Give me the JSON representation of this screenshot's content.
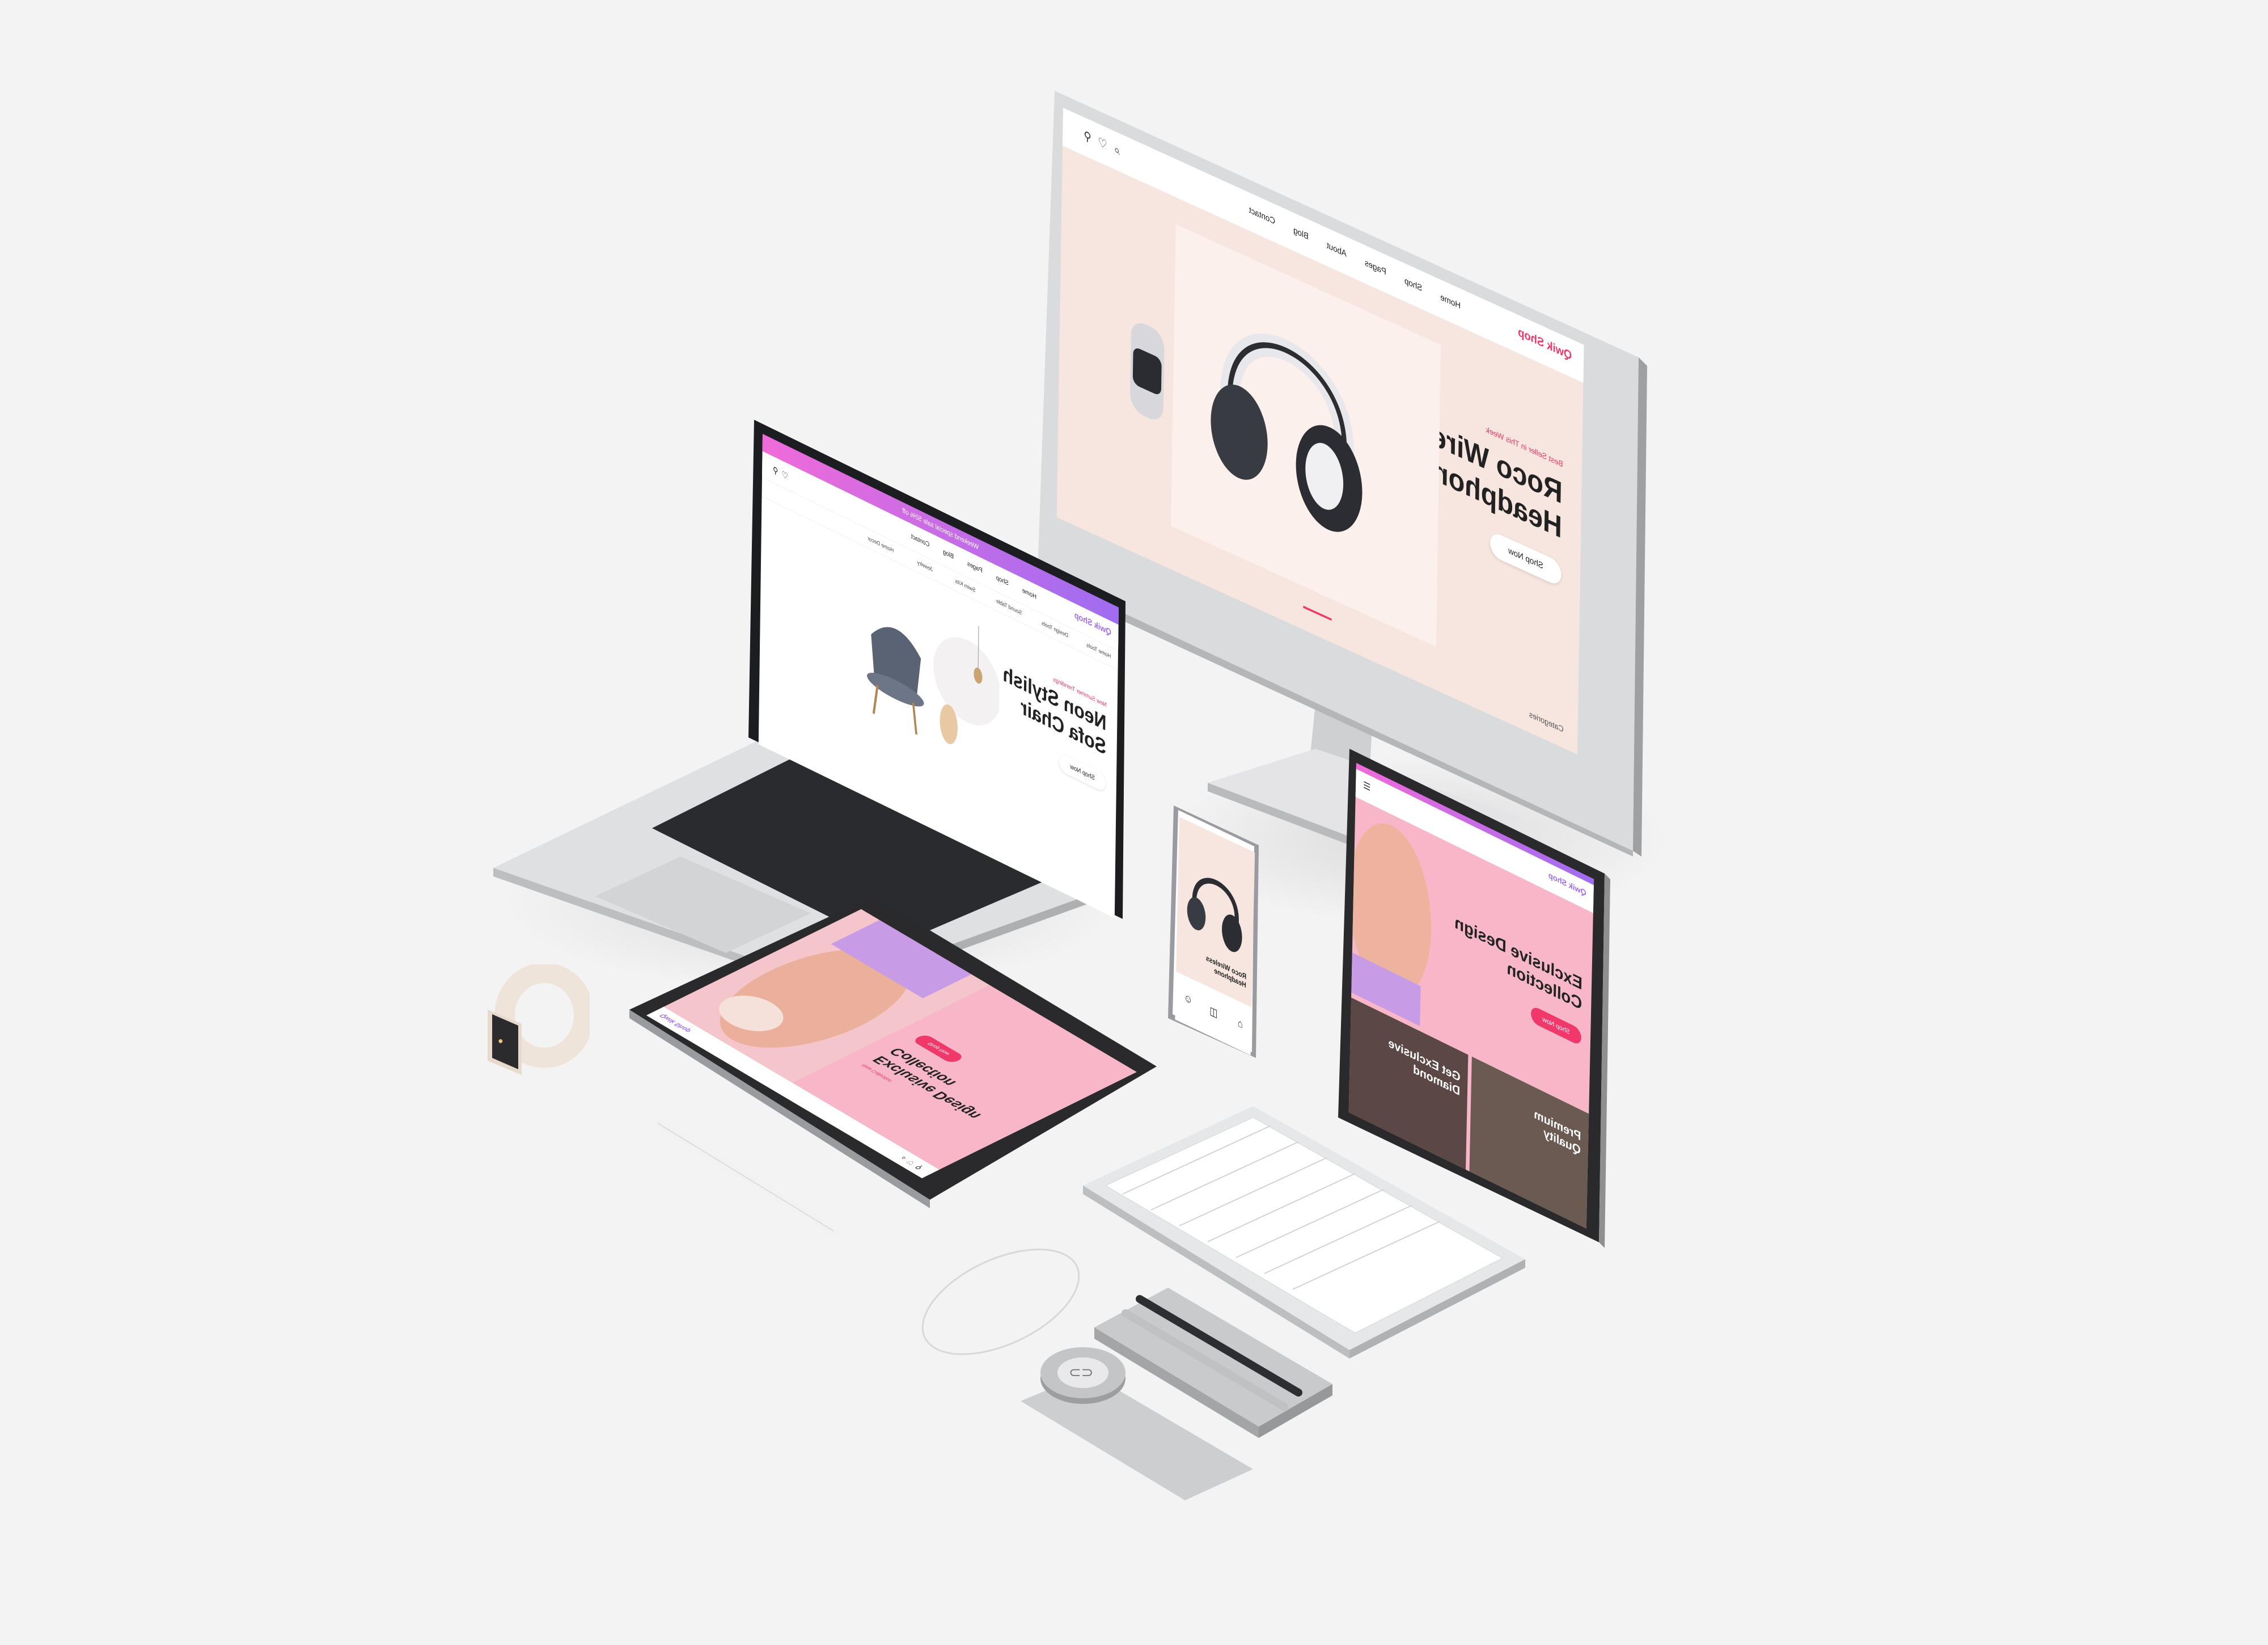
{
  "brand": {
    "name": "Qwik Shop",
    "logo_icon": "colorful-flower-logo"
  },
  "monitor": {
    "nav": [
      "Home",
      "Shop",
      "Pages",
      "About",
      "Blog",
      "Contact"
    ],
    "tag": "Best Seller in This Week",
    "headline_1": "Roco Wireless",
    "headline_2": "Headphone",
    "cta": "Shop Now",
    "footer_link": "Categories",
    "colors": {
      "bg": "#f6e6df",
      "accent": "#f0386b"
    }
  },
  "laptop": {
    "nav": [
      "Home",
      "Shop",
      "Pages",
      "Blog",
      "Contact"
    ],
    "banner": "Weekend special sale 50% off",
    "categories": [
      "Home Tools",
      "Design Tools",
      "Sound Table",
      "Swim Kits",
      "Jewelry",
      "Home Decor"
    ],
    "tag": "New Summer Trendings",
    "headline_1": "Neon Stylish",
    "headline_2": "Sofa Chair",
    "cta": "Shop Now",
    "colors": {
      "gradient_start": "#9f6cf2",
      "gradient_end": "#f06bd9"
    }
  },
  "tablet_flat": {
    "tag": "New Collection",
    "headline_1": "Exclusive Design",
    "headline_2": "Collection",
    "cta": "Shop Now",
    "colors": {
      "bg": "#f7b7c8",
      "accent": "#f0386b"
    }
  },
  "tablet_stand": {
    "headline_1": "Exclusive Design",
    "headline_2": "Collection",
    "cta": "Shop Now",
    "promo_1_line1": "Get Exclusive",
    "promo_1_line2": "Diamond",
    "promo_2_line1": "Premium",
    "promo_2_line2": "Quality"
  },
  "phone": {
    "product": "Roco Wireless Headphone"
  },
  "accessories": [
    "smartwatch",
    "stylus-pencil",
    "keyboard",
    "mouse",
    "pen-tray",
    "paper-clip-holder"
  ]
}
